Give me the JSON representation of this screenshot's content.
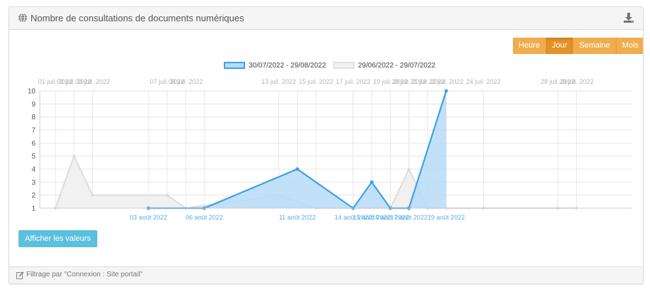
{
  "header": {
    "title": "Nombre de consultations de documents numériques",
    "icon": "globe-icon",
    "download_icon": "download-icon"
  },
  "period_buttons": [
    {
      "label": "Heure",
      "active": false
    },
    {
      "label": "Jour",
      "active": true
    },
    {
      "label": "Semaine",
      "active": false
    },
    {
      "label": "Mois",
      "active": false
    }
  ],
  "legend": {
    "current": "30/07/2022 - 29/08/2022",
    "previous": "29/06/2022 - 29/07/2022"
  },
  "actions": {
    "show_values": "Afficher les valeurs"
  },
  "footer": {
    "filter_text": "Filtrage par \"Connexion : Site portail\"",
    "icon": "edit-icon"
  },
  "colors": {
    "current_line": "#3da2e6",
    "current_fill": "#b7daf7",
    "previous_line": "#dcdcdc",
    "previous_fill": "#efefef",
    "period_button": "#f0ad4e",
    "values_button": "#5bc0de"
  },
  "chart_data": {
    "type": "area",
    "ylim": [
      1,
      10
    ],
    "yticks": [
      1,
      2,
      3,
      4,
      5,
      6,
      7,
      8,
      9,
      10
    ],
    "grid": true,
    "legend_position": "top-center",
    "x_top_ticks": [
      "01 juil. 2022",
      "02 juil. 2022",
      "03 juil. 2022",
      "07 juil. 2022",
      "08 juil. 2022",
      "13 juil. 2022",
      "15 juil. 2022",
      "17 juil. 2022",
      "19 juil. 2022",
      "20 juil. 2022",
      "21 juil. 2022",
      "22 juil. 2022",
      "24 juil. 2022",
      "28 juil. 2022",
      "29 juil. 2022"
    ],
    "x_bottom_ticks": [
      "03 août 2022",
      "06 août 2022",
      "11 août 2022",
      "14 août 2022",
      "15 août 2022",
      "16 août 2022",
      "17 août 2022",
      "19 août 2022"
    ],
    "series": [
      {
        "name": "30/07/2022 - 29/08/2022",
        "x": [
          "03 août 2022",
          "06 août 2022",
          "11 août 2022",
          "14 août 2022",
          "15 août 2022",
          "16 août 2022",
          "17 août 2022",
          "19 août 2022"
        ],
        "values": [
          1,
          1,
          4,
          1,
          3,
          1,
          1,
          10
        ]
      },
      {
        "name": "29/06/2022 - 29/07/2022",
        "x": [
          "01 juil. 2022",
          "02 juil. 2022",
          "03 juil. 2022",
          "07 juil. 2022",
          "08 juil. 2022",
          "13 juil. 2022",
          "15 juil. 2022",
          "17 juil. 2022",
          "19 juil. 2022",
          "20 juil. 2022",
          "21 juil. 2022",
          "22 juil. 2022",
          "24 juil. 2022",
          "28 juil. 2022",
          "29 juil. 2022"
        ],
        "values": [
          1,
          5,
          2,
          2,
          1,
          2,
          1,
          1,
          1,
          4,
          1,
          1,
          1,
          1,
          1
        ]
      }
    ]
  }
}
